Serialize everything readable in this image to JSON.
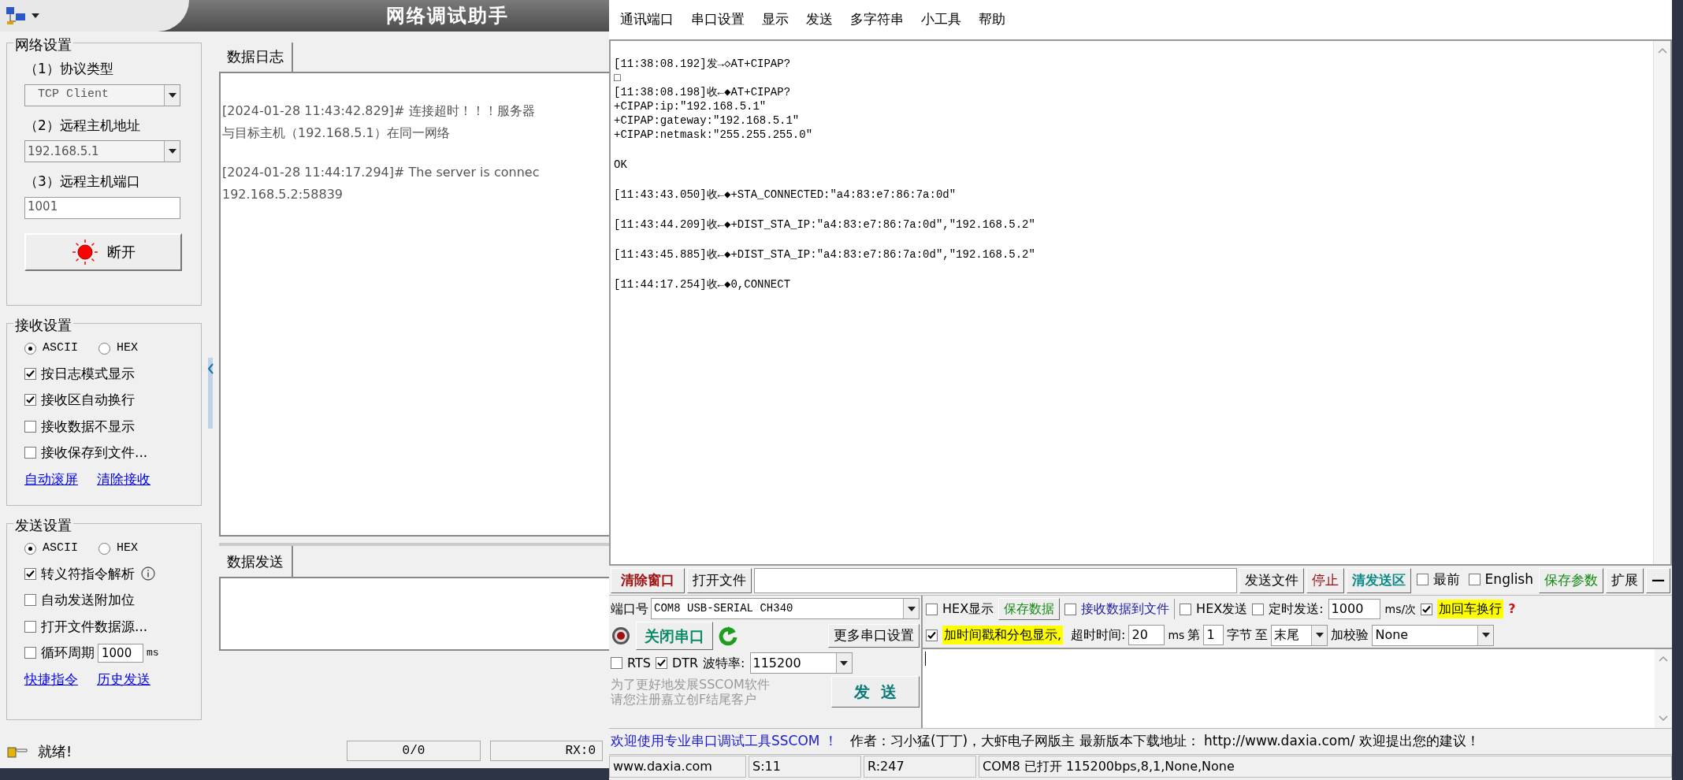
{
  "net_assistant": {
    "title": "网络调试助手",
    "network_settings": {
      "heading": "网络设置",
      "protocol_label": "（1）协议类型",
      "protocol": "TCP Client",
      "host_label": "（2）远程主机地址",
      "host": "192.168.5.1",
      "port_label": "（3）远程主机端口",
      "port": "1001",
      "connect_button": "断开"
    },
    "receive_settings": {
      "heading": "接收设置",
      "encodings": [
        {
          "label": "ASCII",
          "selected": true
        },
        {
          "label": "HEX",
          "selected": false
        }
      ],
      "options": [
        {
          "kind": "check",
          "label": "按日志模式显示",
          "checked": true,
          "info": false
        },
        {
          "kind": "check",
          "label": "接收区自动换行",
          "checked": true,
          "info": false
        },
        {
          "kind": "check",
          "label": "接收数据不显示",
          "checked": false,
          "info": false
        },
        {
          "kind": "check",
          "label": "接收保存到文件...",
          "checked": false,
          "info": false
        }
      ],
      "links": [
        "自动滚屏",
        "清除接收"
      ]
    },
    "send_settings": {
      "heading": "发送设置",
      "encodings": [
        {
          "label": "ASCII",
          "selected": true
        },
        {
          "label": "HEX",
          "selected": false
        }
      ],
      "options": [
        {
          "kind": "check",
          "label": "转义符指令解析",
          "checked": true,
          "info": true
        },
        {
          "kind": "check",
          "label": "自动发送附加位",
          "checked": false,
          "info": false
        },
        {
          "kind": "check",
          "label": "打开文件数据源...",
          "checked": false,
          "info": false
        },
        {
          "kind": "interval",
          "label": "循环周期",
          "checked": false,
          "value": "1000",
          "unit": "ms"
        }
      ],
      "links": [
        "快捷指令",
        "历史发送"
      ]
    },
    "log_tab": "数据日志",
    "log": [
      {
        "lines": [
          "[2024-01-28 11:43:42.829]# 连接超时！！！服务器",
          "与目标主机（192.168.5.1）在同一网络"
        ]
      },
      {
        "lines": [
          "[2024-01-28 11:44:17.294]# The server is connec",
          "192.168.5.2:58839"
        ]
      }
    ],
    "send_tab": "数据发送",
    "status": {
      "text": "就绪!",
      "counter": "0/0",
      "rx": "RX:0"
    }
  },
  "sscom": {
    "menu": [
      "通讯端口",
      "串口设置",
      "显示",
      "发送",
      "多字符串",
      "小工具",
      "帮助"
    ],
    "log": [
      {
        "lines": [
          "[11:38:08.192]发→◇AT+CIPAP?",
          "□",
          "[11:38:08.198]收←◆AT+CIPAP?",
          "+CIPAP:ip:\"192.168.5.1\"",
          "+CIPAP:gateway:\"192.168.5.1\"",
          "+CIPAP:netmask:\"255.255.255.0\""
        ]
      },
      {
        "lines": [
          "OK"
        ]
      },
      {
        "lines": [
          "[11:43:43.050]收←◆+STA_CONNECTED:\"a4:83:e7:86:7a:0d\""
        ]
      },
      {
        "lines": [
          "[11:43:44.209]收←◆+DIST_STA_IP:\"a4:83:e7:86:7a:0d\",\"192.168.5.2\""
        ]
      },
      {
        "lines": [
          "[11:43:45.885]收←◆+DIST_STA_IP:\"a4:83:e7:86:7a:0d\",\"192.168.5.2\""
        ]
      },
      {
        "lines": [
          "[11:44:17.254]收←◆0,CONNECT"
        ]
      }
    ],
    "toolbar": {
      "clear_button": "清除窗口",
      "open_file_button": "打开文件",
      "send_file_button": "发送文件",
      "stop_button": "停止",
      "clear_send_button": "清发送区",
      "topmost": {
        "label": "最前",
        "checked": false
      },
      "english": {
        "label": "English",
        "checked": false
      },
      "save_params_button": "保存参数",
      "expand_button": "扩展",
      "minimize_button": "—"
    },
    "port": {
      "label": "端口号",
      "value": "COM8 USB-SERIAL CH340",
      "close_button": "关闭串口",
      "more_button": "更多串口设置",
      "rts": {
        "label": "RTS",
        "checked": false
      },
      "dtr": {
        "label": "DTR",
        "checked": true
      },
      "baud_label": "波特率:",
      "baud": "115200",
      "promo": [
        "为了更好地发展SSCOM软件",
        "请您注册嘉立创F结尾客户"
      ],
      "send_button": "发  送"
    },
    "options": {
      "hex_display": {
        "label": "HEX显示",
        "checked": false
      },
      "save_data_button": "保存数据",
      "receive_to_file": {
        "label": "接收数据到文件",
        "checked": false
      },
      "hex_send": {
        "label": "HEX发送",
        "checked": false
      },
      "timed_send": {
        "label": "定时发送:",
        "checked": false
      },
      "interval": "1000",
      "interval_unit": "ms/次",
      "append_newline": {
        "label": "加回车换行",
        "checked": true
      },
      "help": "?",
      "timestamp": {
        "label": "加时间戳和分包显示,",
        "checked": true
      },
      "timeout_label": "超时时间:",
      "timeout": "20",
      "timeout_unit": "ms",
      "from_label": "第",
      "from": "1",
      "byte_label": "字节",
      "to_label": "至",
      "to": "末尾",
      "checksum_label": "加校验",
      "checksum": "None"
    },
    "marquee": {
      "welcome": "欢迎使用专业串口调试工具SSCOM ！",
      "info": "作者：习小猛(丁丁)，大虾电子网版主  最新版本下载地址： http://www.daxia.com/  欢迎提出您的建议！"
    },
    "status": [
      "www.daxia.com",
      "S:11",
      "R:247",
      "COM8 已打开  115200bps,8,1,None,None"
    ]
  }
}
